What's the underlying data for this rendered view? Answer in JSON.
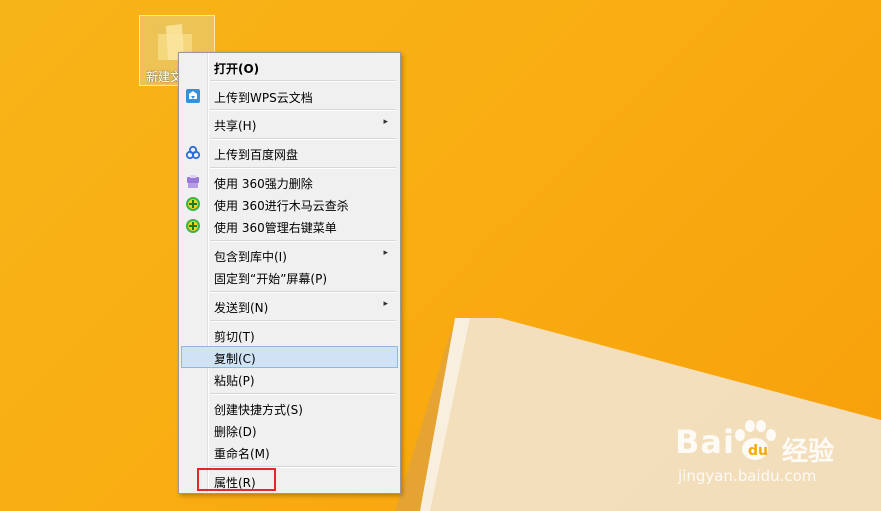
{
  "desktop": {
    "icon_label": "新建文"
  },
  "context_menu": {
    "items": [
      {
        "label": "打开(O)",
        "bold": true
      },
      {
        "label": "上传到WPS云文档",
        "icon": "wps-cloud-icon"
      },
      {
        "label": "共享(H)",
        "submenu": true
      },
      {
        "label": "上传到百度网盘",
        "icon": "baidu-netdisk-icon"
      },
      {
        "label": "使用 360强力删除",
        "icon": "360-shredder-icon"
      },
      {
        "label": "使用 360进行木马云查杀",
        "icon": "360-antivirus-icon"
      },
      {
        "label": "使用 360管理右键菜单",
        "icon": "360-antivirus-icon"
      },
      {
        "label": "包含到库中(I)",
        "submenu": true
      },
      {
        "label": "固定到“开始”屏幕(P)"
      },
      {
        "label": "发送到(N)",
        "submenu": true
      },
      {
        "label": "剪切(T)"
      },
      {
        "label": "复制(C)",
        "highlighted": true
      },
      {
        "label": "粘贴(P)"
      },
      {
        "label": "创建快捷方式(S)"
      },
      {
        "label": "删除(D)"
      },
      {
        "label": "重命名(M)"
      },
      {
        "label": "属性(R)",
        "outlined": true
      }
    ],
    "submenu_arrow": "▸"
  },
  "watermark": {
    "brand": "Bai",
    "brand2": "经验",
    "url": "jingyan.baidu.com"
  },
  "colors": {
    "highlight_outline": "#e5262d",
    "selection_bg": "#d0e3f4"
  }
}
